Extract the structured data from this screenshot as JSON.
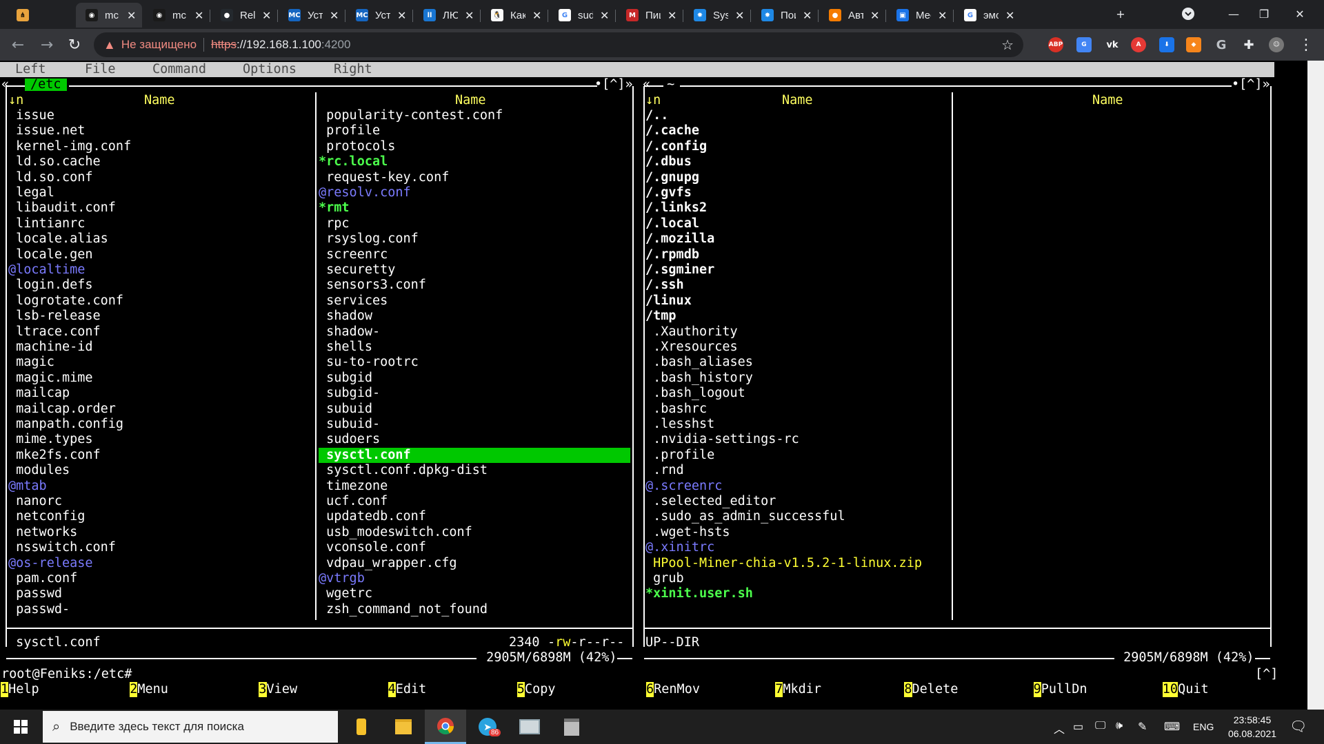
{
  "browser": {
    "tabs": [
      {
        "title": "mc",
        "icon": "mc-terminal-icon",
        "active": true
      },
      {
        "title": "mc",
        "icon": "mc-terminal-icon",
        "active": false
      },
      {
        "title": "Rele",
        "icon": "github-icon",
        "active": false
      },
      {
        "title": "Уста",
        "icon": "mc-site-icon",
        "active": false
      },
      {
        "title": "Уста",
        "icon": "mc-site-icon",
        "active": false
      },
      {
        "title": "ЛЮ",
        "icon": "blue-page-icon",
        "active": false
      },
      {
        "title": "Как",
        "icon": "linux-tux-icon",
        "active": false
      },
      {
        "title": "sudo",
        "icon": "google-icon",
        "active": false
      },
      {
        "title": "Пиш",
        "icon": "red-m-icon",
        "active": false
      },
      {
        "title": "Syst",
        "icon": "gear-site-icon",
        "active": false
      },
      {
        "title": "Пои",
        "icon": "gear-site-icon",
        "active": false
      },
      {
        "title": "Авт",
        "icon": "orange-circle-icon",
        "active": false
      },
      {
        "title": "Мес",
        "icon": "messages-icon",
        "active": false
      },
      {
        "title": "эмо",
        "icon": "google-icon",
        "active": false
      }
    ],
    "first_tab_icon": "browser-app-icon",
    "new_tab": "+",
    "omnibox": {
      "security_label": "Не защищено",
      "scheme": "https",
      "host": "://192.168.1.100",
      "port": ":4200"
    },
    "extensions": [
      "adblock-icon",
      "translate-icon",
      "vk-icon",
      "red-a-icon",
      "download-icon",
      "metamask-icon",
      "google-g-icon",
      "puzzle-icon",
      "avatar-icon"
    ]
  },
  "mc": {
    "menu": {
      "left": "Left",
      "file": "File",
      "command": "Command",
      "options": "Options",
      "right": "Right"
    },
    "left_panel": {
      "path": "/etc",
      "corner_left": "«",
      "corner_right": "•[^]»",
      "sort_indicator": "↓n",
      "col1_header": "Name",
      "col2_header": "Name",
      "col1": [
        {
          "name": " issue",
          "type": "file"
        },
        {
          "name": " issue.net",
          "type": "file"
        },
        {
          "name": " kernel-img.conf",
          "type": "file"
        },
        {
          "name": " ld.so.cache",
          "type": "file"
        },
        {
          "name": " ld.so.conf",
          "type": "file"
        },
        {
          "name": " legal",
          "type": "file"
        },
        {
          "name": " libaudit.conf",
          "type": "file"
        },
        {
          "name": " lintianrc",
          "type": "file"
        },
        {
          "name": " locale.alias",
          "type": "file"
        },
        {
          "name": " locale.gen",
          "type": "file"
        },
        {
          "name": "@localtime",
          "type": "link"
        },
        {
          "name": " login.defs",
          "type": "file"
        },
        {
          "name": " logrotate.conf",
          "type": "file"
        },
        {
          "name": " lsb-release",
          "type": "file"
        },
        {
          "name": " ltrace.conf",
          "type": "file"
        },
        {
          "name": " machine-id",
          "type": "file"
        },
        {
          "name": " magic",
          "type": "file"
        },
        {
          "name": " magic.mime",
          "type": "file"
        },
        {
          "name": " mailcap",
          "type": "file"
        },
        {
          "name": " mailcap.order",
          "type": "file"
        },
        {
          "name": " manpath.config",
          "type": "file"
        },
        {
          "name": " mime.types",
          "type": "file"
        },
        {
          "name": " mke2fs.conf",
          "type": "file"
        },
        {
          "name": " modules",
          "type": "file"
        },
        {
          "name": "@mtab",
          "type": "link"
        },
        {
          "name": " nanorc",
          "type": "file"
        },
        {
          "name": " netconfig",
          "type": "file"
        },
        {
          "name": " networks",
          "type": "file"
        },
        {
          "name": " nsswitch.conf",
          "type": "file"
        },
        {
          "name": "@os-release",
          "type": "link"
        },
        {
          "name": " pam.conf",
          "type": "file"
        },
        {
          "name": " passwd",
          "type": "file"
        },
        {
          "name": " passwd-",
          "type": "file"
        }
      ],
      "col2": [
        {
          "name": " popularity-contest.conf",
          "type": "file"
        },
        {
          "name": " profile",
          "type": "file"
        },
        {
          "name": " protocols",
          "type": "file"
        },
        {
          "name": "*rc.local",
          "type": "exec"
        },
        {
          "name": " request-key.conf",
          "type": "file"
        },
        {
          "name": "@resolv.conf",
          "type": "link"
        },
        {
          "name": "*rmt",
          "type": "exec"
        },
        {
          "name": " rpc",
          "type": "file"
        },
        {
          "name": " rsyslog.conf",
          "type": "file"
        },
        {
          "name": " screenrc",
          "type": "file"
        },
        {
          "name": " securetty",
          "type": "file"
        },
        {
          "name": " sensors3.conf",
          "type": "file"
        },
        {
          "name": " services",
          "type": "file"
        },
        {
          "name": " shadow",
          "type": "file"
        },
        {
          "name": " shadow-",
          "type": "file"
        },
        {
          "name": " shells",
          "type": "file"
        },
        {
          "name": " su-to-rootrc",
          "type": "file"
        },
        {
          "name": " subgid",
          "type": "file"
        },
        {
          "name": " subgid-",
          "type": "file"
        },
        {
          "name": " subuid",
          "type": "file"
        },
        {
          "name": " subuid-",
          "type": "file"
        },
        {
          "name": " sudoers",
          "type": "file"
        },
        {
          "name": " sysctl.conf",
          "type": "sel"
        },
        {
          "name": " sysctl.conf.dpkg-dist",
          "type": "file"
        },
        {
          "name": " timezone",
          "type": "file"
        },
        {
          "name": " ucf.conf",
          "type": "file"
        },
        {
          "name": " updatedb.conf",
          "type": "file"
        },
        {
          "name": " usb_modeswitch.conf",
          "type": "file"
        },
        {
          "name": " vconsole.conf",
          "type": "file"
        },
        {
          "name": " vdpau_wrapper.cfg",
          "type": "file"
        },
        {
          "name": "@vtrgb",
          "type": "link"
        },
        {
          "name": " wgetrc",
          "type": "file"
        },
        {
          "name": " zsh_command_not_found",
          "type": "file"
        }
      ],
      "status_name": " sysctl.conf",
      "status_size": "2340",
      "status_perm_prefix": "-",
      "status_perm_owner": "rw",
      "status_perm_rest": "-r--r--",
      "disk": " 2905M/6898M (42%) "
    },
    "right_panel": {
      "path": " ~ ",
      "corner_left": "«",
      "corner_right": "•[^]»",
      "sort_indicator": "↓n",
      "col1_header": "Name",
      "col2_header": "Name",
      "col1": [
        {
          "name": "/..",
          "type": "dir"
        },
        {
          "name": "/.cache",
          "type": "dir"
        },
        {
          "name": "/.config",
          "type": "dir"
        },
        {
          "name": "/.dbus",
          "type": "dir"
        },
        {
          "name": "/.gnupg",
          "type": "dir"
        },
        {
          "name": "/.gvfs",
          "type": "dir"
        },
        {
          "name": "/.links2",
          "type": "dir"
        },
        {
          "name": "/.local",
          "type": "dir"
        },
        {
          "name": "/.mozilla",
          "type": "dir"
        },
        {
          "name": "/.rpmdb",
          "type": "dir"
        },
        {
          "name": "/.sgminer",
          "type": "dir"
        },
        {
          "name": "/.ssh",
          "type": "dir"
        },
        {
          "name": "/linux",
          "type": "dir"
        },
        {
          "name": "/tmp",
          "type": "dir"
        },
        {
          "name": " .Xauthority",
          "type": "file"
        },
        {
          "name": " .Xresources",
          "type": "file"
        },
        {
          "name": " .bash_aliases",
          "type": "file"
        },
        {
          "name": " .bash_history",
          "type": "file"
        },
        {
          "name": " .bash_logout",
          "type": "file"
        },
        {
          "name": " .bashrc",
          "type": "file"
        },
        {
          "name": " .lesshst",
          "type": "file"
        },
        {
          "name": " .nvidia-settings-rc",
          "type": "file"
        },
        {
          "name": " .profile",
          "type": "file"
        },
        {
          "name": " .rnd",
          "type": "file"
        },
        {
          "name": "@.screenrc",
          "type": "link"
        },
        {
          "name": " .selected_editor",
          "type": "file"
        },
        {
          "name": " .sudo_as_admin_successful",
          "type": "file"
        },
        {
          "name": " .wget-hsts",
          "type": "file"
        },
        {
          "name": "@.xinitrc",
          "type": "link"
        },
        {
          "name": " HPool-Miner-chia-v1.5.2-1-linux.zip",
          "type": "arch"
        },
        {
          "name": " grub",
          "type": "file"
        },
        {
          "name": "*xinit.user.sh",
          "type": "exec"
        }
      ],
      "status_name": "UP--DIR",
      "disk": " 2905M/6898M (42%) "
    },
    "prompt": "root@Feniks:/etc#",
    "prompt_right": "[^]",
    "fkeys": [
      {
        "num": "1",
        "label": "Help"
      },
      {
        "num": "2",
        "label": "Menu"
      },
      {
        "num": "3",
        "label": "View"
      },
      {
        "num": "4",
        "label": "Edit"
      },
      {
        "num": "5",
        "label": "Copy"
      },
      {
        "num": "6",
        "label": "RenMov"
      },
      {
        "num": "7",
        "label": "Mkdir"
      },
      {
        "num": "8",
        "label": "Delete"
      },
      {
        "num": "9",
        "label": "PullDn"
      },
      {
        "num": "10",
        "label": "Quit"
      }
    ]
  },
  "taskbar": {
    "search_placeholder": "Введите здесь текст для поиска",
    "apps": [
      "notes-app-icon",
      "file-explorer-icon",
      "chrome-icon",
      "telegram-icon",
      "remote-desktop-icon",
      "package-icon"
    ],
    "telegram_badge": "86",
    "language": "ENG",
    "time": "23:58:45",
    "date": "06.08.2021"
  },
  "colors": {
    "mc_selection": "#00c800",
    "mc_link": "#7b7bff",
    "mc_exec": "#4cff4c",
    "mc_header": "#ffff60",
    "fkey_bg": "#ffff33",
    "chrome_bg": "#202124",
    "chrome_toolbar": "#35363a"
  }
}
